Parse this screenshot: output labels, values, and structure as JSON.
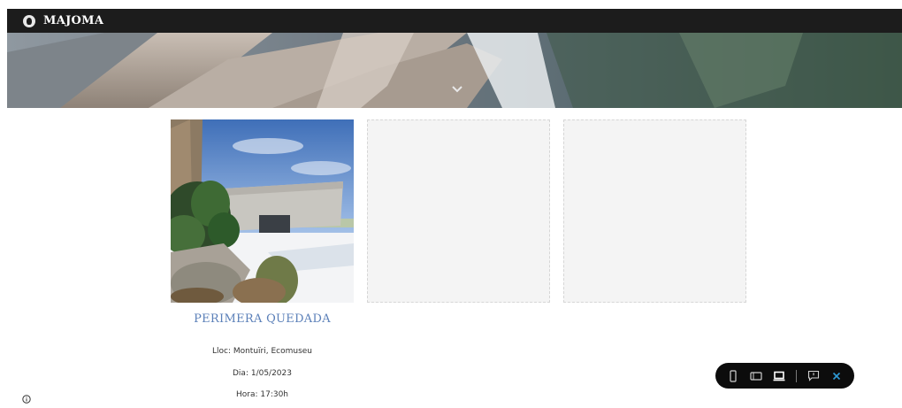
{
  "header": {
    "brand": "MAJOMA",
    "logo_icon": "logo-icon"
  },
  "hero": {
    "scroll_icon": "chevron-down-icon"
  },
  "event": {
    "title": "PERIMERA QUEDADA",
    "location": "Lloc: Montuïri, Ecomuseu",
    "date": "Dia: 1/05/2023",
    "time": "Hora: 17:30h"
  },
  "gallery": {
    "placeholders": 2
  },
  "toolbar": {
    "buttons": [
      "mobile-view-icon",
      "tablet-view-icon",
      "desktop-view-icon",
      "feedback-icon",
      "close-icon"
    ],
    "accent": "#2f9bd6"
  },
  "colors": {
    "topbar": "#1c1c1c",
    "title": "#5a7fb8",
    "placeholder": "#f4f4f4"
  }
}
